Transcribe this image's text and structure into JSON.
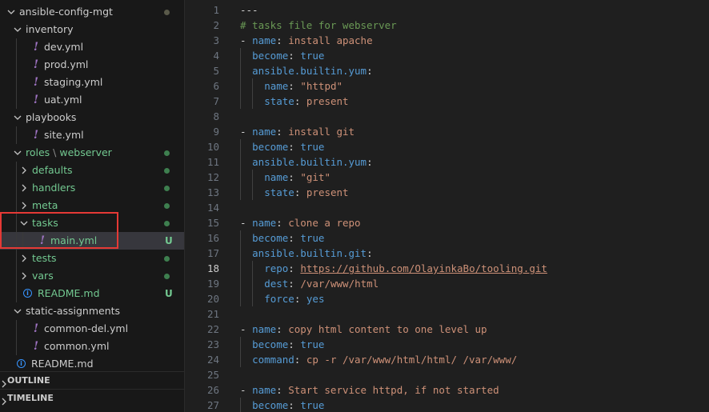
{
  "explorer": {
    "tree": [
      {
        "label": "ansible-config-mgt",
        "depth": 0,
        "kind": "folder",
        "expanded": true,
        "dot": "gray"
      },
      {
        "label": "inventory",
        "depth": 1,
        "kind": "folder",
        "expanded": true
      },
      {
        "label": "dev.yml",
        "depth": 2,
        "kind": "yml"
      },
      {
        "label": "prod.yml",
        "depth": 2,
        "kind": "yml"
      },
      {
        "label": "staging.yml",
        "depth": 2,
        "kind": "yml"
      },
      {
        "label": "uat.yml",
        "depth": 2,
        "kind": "yml"
      },
      {
        "label": "playbooks",
        "depth": 1,
        "kind": "folder",
        "expanded": true
      },
      {
        "label": "site.yml",
        "depth": 2,
        "kind": "yml"
      },
      {
        "label": "roles",
        "label2": "webserver",
        "depth": 1,
        "kind": "folder",
        "expanded": true,
        "green": true,
        "dot": "green"
      },
      {
        "label": "defaults",
        "depth": 2,
        "kind": "folder",
        "expanded": false,
        "green": true,
        "dot": "green"
      },
      {
        "label": "handlers",
        "depth": 2,
        "kind": "folder",
        "expanded": false,
        "green": true,
        "dot": "green"
      },
      {
        "label": "meta",
        "depth": 2,
        "kind": "folder",
        "expanded": false,
        "green": true,
        "dot": "green"
      },
      {
        "label": "tasks",
        "depth": 2,
        "kind": "folder",
        "expanded": true,
        "green": true,
        "dot": "green"
      },
      {
        "label": "main.yml",
        "depth": 3,
        "kind": "yml",
        "green": true,
        "badge": "U",
        "selected": true
      },
      {
        "label": "tests",
        "depth": 2,
        "kind": "folder",
        "expanded": false,
        "green": true,
        "dot": "green"
      },
      {
        "label": "vars",
        "depth": 2,
        "kind": "folder",
        "expanded": false,
        "green": true,
        "dot": "green"
      },
      {
        "label": "README.md",
        "depth": 2,
        "kind": "info",
        "green": true,
        "badge": "U"
      },
      {
        "label": "static-assignments",
        "depth": 1,
        "kind": "folder",
        "expanded": true
      },
      {
        "label": "common-del.yml",
        "depth": 2,
        "kind": "yml"
      },
      {
        "label": "common.yml",
        "depth": 2,
        "kind": "yml"
      },
      {
        "label": "README.md",
        "depth": 1,
        "kind": "info"
      }
    ],
    "sections": [
      "OUTLINE",
      "TIMELINE"
    ]
  },
  "editor": {
    "active_line": 18,
    "lines": [
      {
        "n": "1",
        "indent": 0,
        "tokens": [
          [
            "p",
            "---"
          ]
        ]
      },
      {
        "n": "2",
        "indent": 0,
        "tokens": [
          [
            "c",
            "# tasks file for webserver"
          ]
        ]
      },
      {
        "n": "3",
        "indent": 0,
        "tokens": [
          [
            "p",
            "- "
          ],
          [
            "k",
            "name"
          ],
          [
            "p",
            ": "
          ],
          [
            "s",
            "install apache"
          ]
        ]
      },
      {
        "n": "4",
        "indent": 1,
        "tokens": [
          [
            "k",
            "become"
          ],
          [
            "p",
            ": "
          ],
          [
            "k",
            "true"
          ]
        ]
      },
      {
        "n": "5",
        "indent": 1,
        "tokens": [
          [
            "k",
            "ansible.builtin.yum"
          ],
          [
            "p",
            ":"
          ]
        ]
      },
      {
        "n": "6",
        "indent": 2,
        "tokens": [
          [
            "k",
            "name"
          ],
          [
            "p",
            ": "
          ],
          [
            "s",
            "\"httpd\""
          ]
        ]
      },
      {
        "n": "7",
        "indent": 2,
        "tokens": [
          [
            "k",
            "state"
          ],
          [
            "p",
            ": "
          ],
          [
            "s",
            "present"
          ]
        ]
      },
      {
        "n": "8",
        "indent": 0,
        "tokens": []
      },
      {
        "n": "9",
        "indent": 0,
        "tokens": [
          [
            "p",
            "- "
          ],
          [
            "k",
            "name"
          ],
          [
            "p",
            ": "
          ],
          [
            "s",
            "install git"
          ]
        ]
      },
      {
        "n": "10",
        "indent": 1,
        "tokens": [
          [
            "k",
            "become"
          ],
          [
            "p",
            ": "
          ],
          [
            "k",
            "true"
          ]
        ]
      },
      {
        "n": "11",
        "indent": 1,
        "tokens": [
          [
            "k",
            "ansible.builtin.yum"
          ],
          [
            "p",
            ":"
          ]
        ]
      },
      {
        "n": "12",
        "indent": 2,
        "tokens": [
          [
            "k",
            "name"
          ],
          [
            "p",
            ": "
          ],
          [
            "s",
            "\"git\""
          ]
        ]
      },
      {
        "n": "13",
        "indent": 2,
        "tokens": [
          [
            "k",
            "state"
          ],
          [
            "p",
            ": "
          ],
          [
            "s",
            "present"
          ]
        ]
      },
      {
        "n": "14",
        "indent": 0,
        "tokens": []
      },
      {
        "n": "15",
        "indent": 0,
        "tokens": [
          [
            "p",
            "- "
          ],
          [
            "k",
            "name"
          ],
          [
            "p",
            ": "
          ],
          [
            "s",
            "clone a repo"
          ]
        ]
      },
      {
        "n": "16",
        "indent": 1,
        "tokens": [
          [
            "k",
            "become"
          ],
          [
            "p",
            ": "
          ],
          [
            "k",
            "true"
          ]
        ]
      },
      {
        "n": "17",
        "indent": 1,
        "tokens": [
          [
            "k",
            "ansible.builtin.git"
          ],
          [
            "p",
            ":"
          ]
        ]
      },
      {
        "n": "18",
        "indent": 2,
        "tokens": [
          [
            "k",
            "repo"
          ],
          [
            "p",
            ": "
          ],
          [
            "su",
            "https://github.com/OlayinkaBo/tooling.git"
          ]
        ]
      },
      {
        "n": "19",
        "indent": 2,
        "tokens": [
          [
            "k",
            "dest"
          ],
          [
            "p",
            ": "
          ],
          [
            "s",
            "/var/www/html"
          ]
        ]
      },
      {
        "n": "20",
        "indent": 2,
        "tokens": [
          [
            "k",
            "force"
          ],
          [
            "p",
            ": "
          ],
          [
            "k",
            "yes"
          ]
        ]
      },
      {
        "n": "21",
        "indent": 0,
        "tokens": []
      },
      {
        "n": "22",
        "indent": 0,
        "tokens": [
          [
            "p",
            "- "
          ],
          [
            "k",
            "name"
          ],
          [
            "p",
            ": "
          ],
          [
            "s",
            "copy html content to one level up"
          ]
        ]
      },
      {
        "n": "23",
        "indent": 1,
        "tokens": [
          [
            "k",
            "become"
          ],
          [
            "p",
            ": "
          ],
          [
            "k",
            "true"
          ]
        ]
      },
      {
        "n": "24",
        "indent": 1,
        "tokens": [
          [
            "k",
            "command"
          ],
          [
            "p",
            ": "
          ],
          [
            "s",
            "cp -r /var/www/html/html/ /var/www/"
          ]
        ]
      },
      {
        "n": "25",
        "indent": 0,
        "tokens": []
      },
      {
        "n": "26",
        "indent": 0,
        "tokens": [
          [
            "p",
            "- "
          ],
          [
            "k",
            "name"
          ],
          [
            "p",
            ": "
          ],
          [
            "s",
            "Start service httpd, if not started"
          ]
        ]
      },
      {
        "n": "27",
        "indent": 1,
        "tokens": [
          [
            "k",
            "become"
          ],
          [
            "p",
            ": "
          ],
          [
            "k",
            "true"
          ]
        ]
      }
    ]
  }
}
